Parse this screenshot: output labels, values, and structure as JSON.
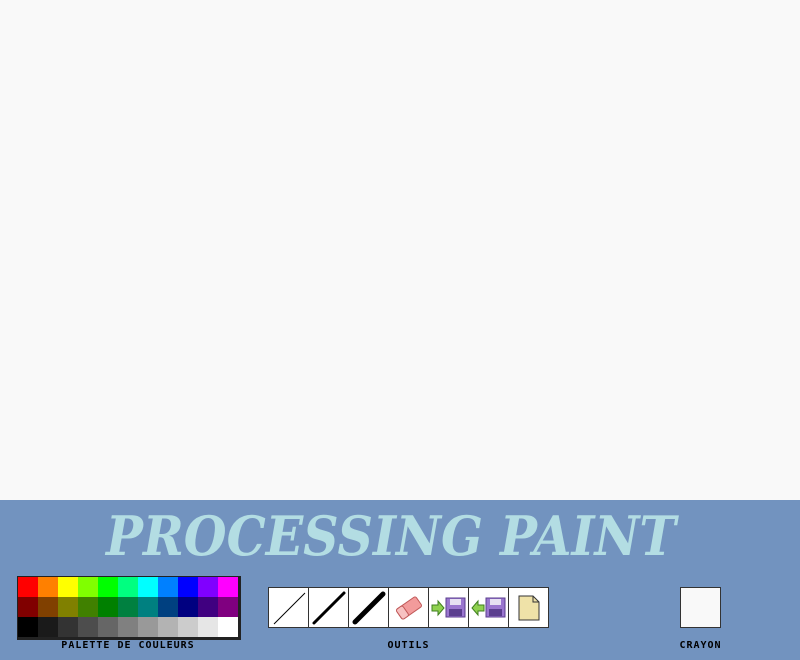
{
  "app": {
    "title": "PROCESSING PAINT",
    "title_color": "#b3dde3",
    "panel_color": "#7293bf",
    "canvas_color": "#f9f9f9"
  },
  "palette": {
    "label": "PALETTE DE COULEURS",
    "rows": [
      [
        "#ff0000",
        "#ff8000",
        "#ffff00",
        "#80ff00",
        "#00ff00",
        "#00ff80",
        "#00ffff",
        "#0080ff",
        "#0000ff",
        "#8000ff",
        "#ff00ff"
      ],
      [
        "#800000",
        "#804000",
        "#808000",
        "#408000",
        "#008000",
        "#008040",
        "#008080",
        "#004080",
        "#000080",
        "#400080",
        "#800080"
      ],
      [
        "#000000",
        "#1a1a1a",
        "#333333",
        "#4d4d4d",
        "#666666",
        "#808080",
        "#999999",
        "#b3b3b3",
        "#cccccc",
        "#e6e6e6",
        "#ffffff"
      ]
    ]
  },
  "tools": {
    "label": "OUTILS",
    "items": [
      {
        "name": "thin-line-tool",
        "icon": "thin-line-icon"
      },
      {
        "name": "medium-line-tool",
        "icon": "medium-line-icon"
      },
      {
        "name": "thick-line-tool",
        "icon": "thick-line-icon"
      },
      {
        "name": "eraser-tool",
        "icon": "eraser-icon"
      },
      {
        "name": "save-tool",
        "icon": "save-icon"
      },
      {
        "name": "load-tool",
        "icon": "load-icon"
      },
      {
        "name": "new-page-tool",
        "icon": "new-page-icon"
      }
    ]
  },
  "pencil": {
    "label": "CRAYON",
    "current_color": "#f9f9f9"
  }
}
